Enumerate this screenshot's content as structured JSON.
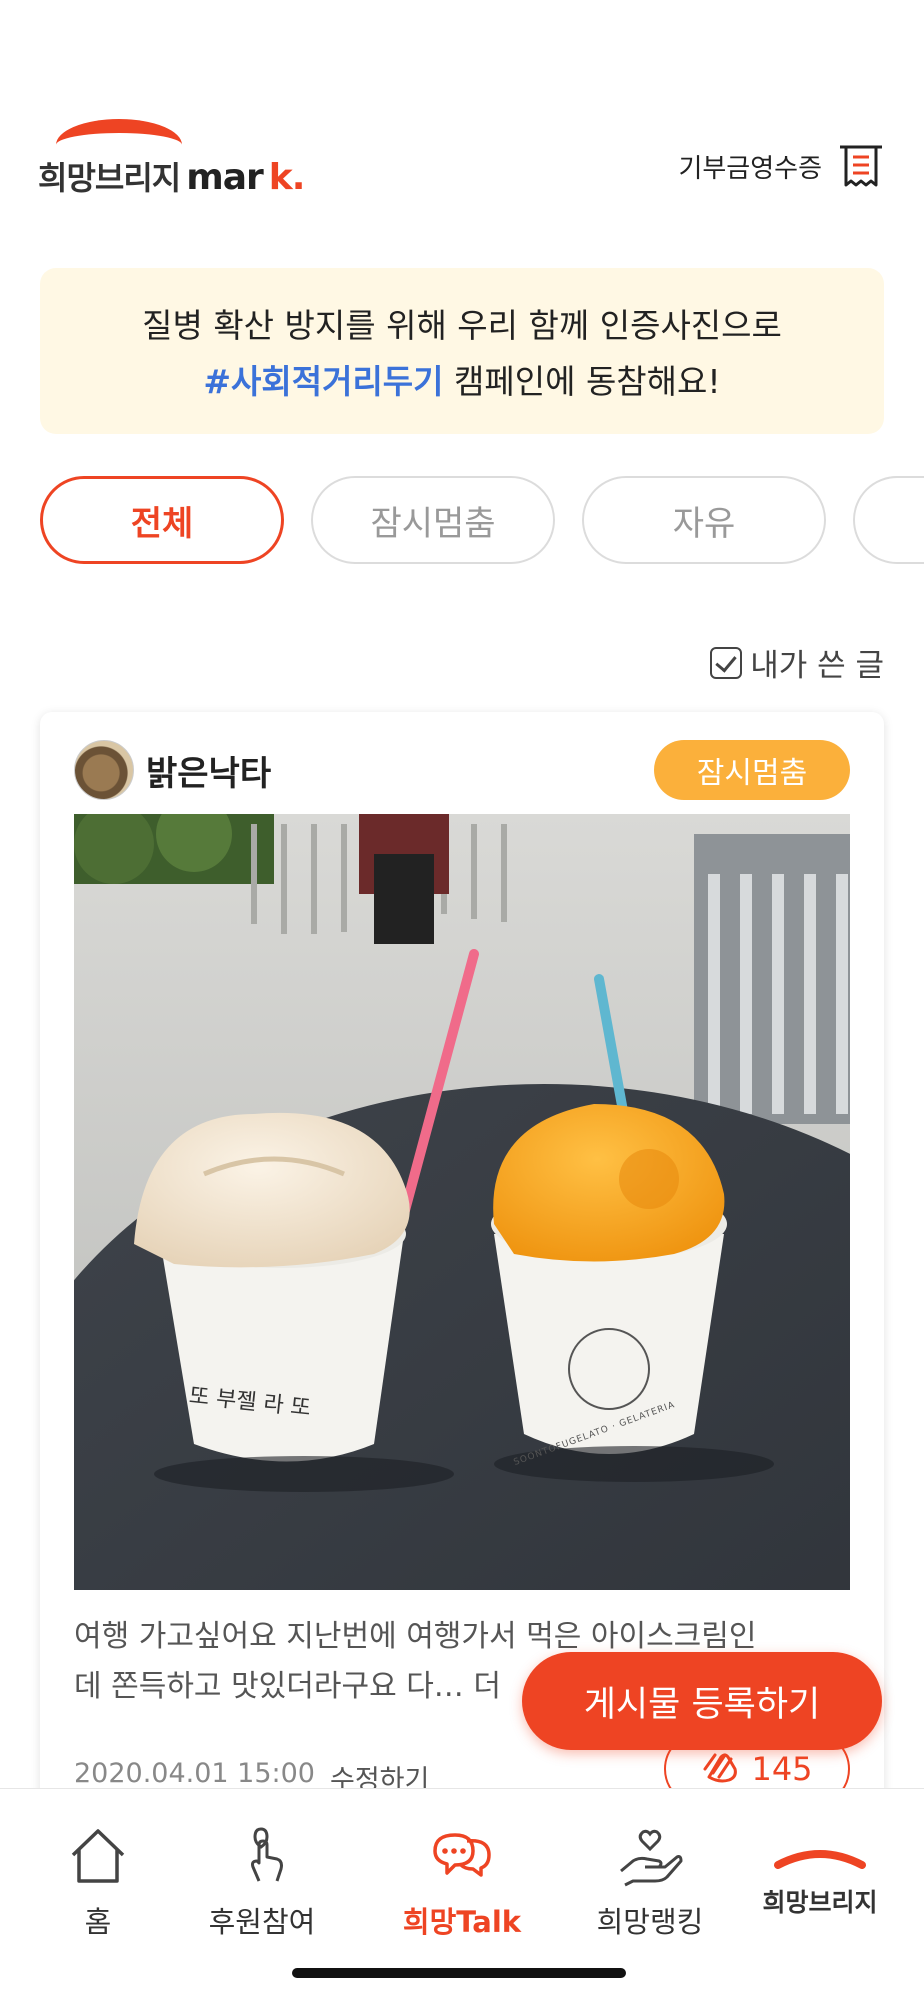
{
  "header": {
    "logo_text": "희망브리지",
    "logo_mark": "mar",
    "logo_k": "k.",
    "receipt_label": "기부금영수증"
  },
  "banner": {
    "line1": "질병 확산 방지를 위해 우리 함께 인증사진으로",
    "hashtag": "#사회적거리두기",
    "line2_rest": " 캠페인에 동참해요!"
  },
  "tabs": [
    {
      "label": "전체",
      "active": true
    },
    {
      "label": "잠시멈춤",
      "active": false
    },
    {
      "label": "자유",
      "active": false
    },
    {
      "label": "",
      "active": false
    }
  ],
  "filter": {
    "mine_label": "내가 쓴 글",
    "checked": true
  },
  "post": {
    "author": "밝은낙타",
    "badge": "잠시멈춤",
    "cup_left_text": "또 부젤 라 또",
    "cup_right_text": "SOONTOFUGELATO · GELATERIA",
    "text_line1": "여행 가고싶어요 지난번에 여행가서 먹은 아이스크림인",
    "text_line2": "데 쫀득하고 맛있더라구요 다… 더",
    "date": "2020.04.01 15:00",
    "edit_label": "수정하기",
    "like_count": "145"
  },
  "fab": {
    "label": "게시물 등록하기"
  },
  "bottom_nav": [
    {
      "label": "홈",
      "icon": "home-icon",
      "active": false
    },
    {
      "label": "후원참여",
      "icon": "touch-heart-icon",
      "active": false
    },
    {
      "label": "희망Talk",
      "icon": "chat-bubble-icon",
      "active": true
    },
    {
      "label": "희망랭킹",
      "icon": "heart-hand-icon",
      "active": false
    },
    {
      "label": "희망브리지",
      "icon": "hopebridge-logo-icon",
      "active": false
    }
  ],
  "colors": {
    "brand": "#ee4423",
    "badge": "#fbb03b",
    "hashtag": "#3b72d9",
    "banner_bg": "#fff8e4"
  }
}
